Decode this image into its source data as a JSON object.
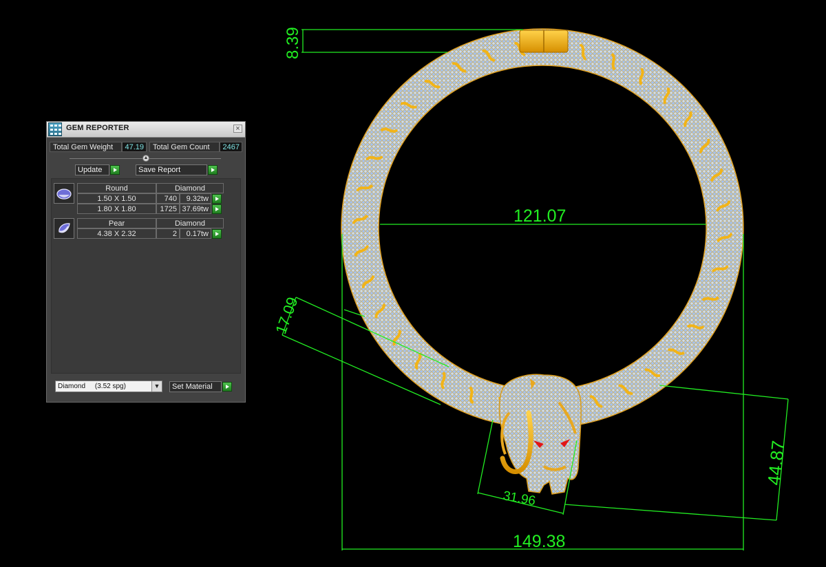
{
  "panel": {
    "title": "GEM REPORTER",
    "total_weight_label": "Total Gem Weight",
    "total_weight_value": "47.19",
    "total_count_label": "Total Gem Count",
    "total_count_value": "2467",
    "update_label": "Update",
    "save_report_label": "Save Report",
    "groups": [
      {
        "shape": "Round",
        "material": "Diamond",
        "rows": [
          {
            "size": "1.50 X 1.50",
            "count": "740",
            "weight": "9.32tw"
          },
          {
            "size": "1.80 X 1.80",
            "count": "1725",
            "weight": "37.69tw"
          }
        ]
      },
      {
        "shape": "Pear",
        "material": "Diamond",
        "rows": [
          {
            "size": "4.38 X 2.32",
            "count": "2",
            "weight": "0.17tw"
          }
        ]
      }
    ],
    "material_select": "Diamond     (3.52 spg)",
    "set_material_label": "Set Material"
  },
  "dimensions": {
    "clasp_height": "8.39",
    "inner_diameter": "121.07",
    "band_width": "17.09",
    "head_width": "31.96",
    "head_height": "44.87",
    "outer_width": "149.38"
  },
  "colors": {
    "dimension": "#22ee22",
    "gems": "#a9c4ee",
    "gold": "#f2b418",
    "eye": "#e21616"
  }
}
